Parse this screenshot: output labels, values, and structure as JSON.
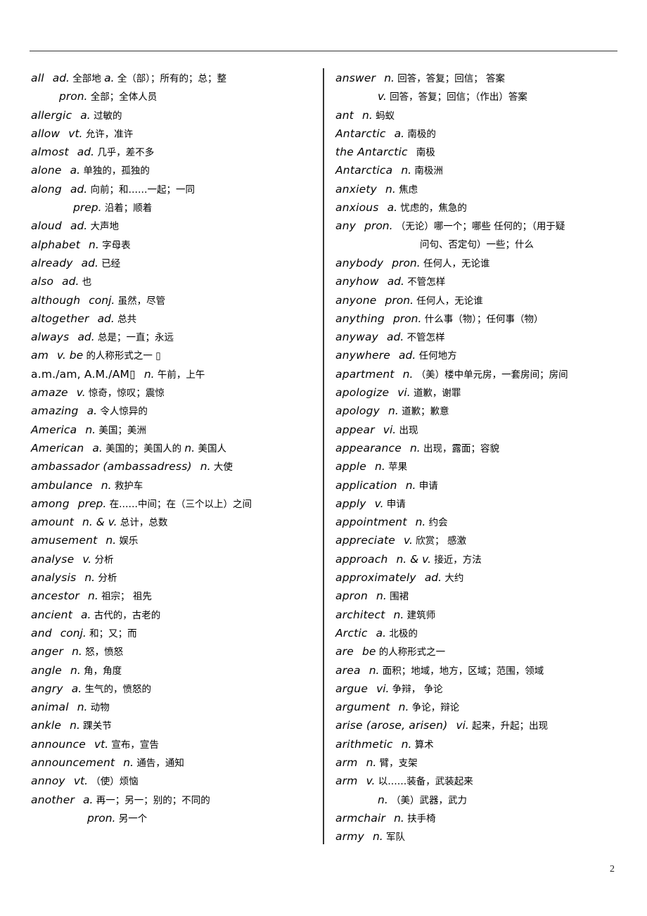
{
  "page_number": "2",
  "left_column": [
    {
      "word": "all",
      "parts": [
        {
          "pos": "ad.",
          "def": "全部地"
        },
        {
          "pos": "a.",
          "def": "全（部）；所有的；总；整"
        }
      ]
    },
    {
      "word": "",
      "indent": 2,
      "parts": [
        {
          "pos": "pron.",
          "def": "全部；全体人员"
        }
      ]
    },
    {
      "word": "allergic",
      "parts": [
        {
          "pos": "a.",
          "def": "过敏的"
        }
      ]
    },
    {
      "word": "allow",
      "parts": [
        {
          "pos": "vt.",
          "def": "允许，准许"
        }
      ]
    },
    {
      "word": "almost",
      "parts": [
        {
          "pos": "ad.",
          "def": "几乎，差不多"
        }
      ]
    },
    {
      "word": "alone",
      "parts": [
        {
          "pos": "a.",
          "def": "单独的，孤独的"
        }
      ]
    },
    {
      "word": "along",
      "parts": [
        {
          "pos": "ad.",
          "def": "向前；和……一起；一同"
        }
      ]
    },
    {
      "word": "",
      "indent": 3,
      "parts": [
        {
          "pos": "prep.",
          "def": "沿着；顺着"
        }
      ]
    },
    {
      "word": "aloud",
      "parts": [
        {
          "pos": "ad.",
          "def": "大声地"
        }
      ]
    },
    {
      "word": "alphabet",
      "parts": [
        {
          "pos": "n.",
          "def": "字母表"
        }
      ]
    },
    {
      "word": "already",
      "parts": [
        {
          "pos": "ad.",
          "def": "已经"
        }
      ]
    },
    {
      "word": "also",
      "parts": [
        {
          "pos": "ad.",
          "def": "也"
        }
      ]
    },
    {
      "word": "although",
      "parts": [
        {
          "pos": "conj.",
          "def": "虽然，尽管"
        }
      ]
    },
    {
      "word": "altogether",
      "parts": [
        {
          "pos": "ad.",
          "def": "总共"
        }
      ]
    },
    {
      "word": "always",
      "parts": [
        {
          "pos": "ad.",
          "def": "总是；一直；永远"
        }
      ]
    },
    {
      "word": "am",
      "parts": [
        {
          "pos": "v. be",
          "def": "的人称形式之一 ▯"
        }
      ]
    },
    {
      "word": "a.m./am, A.M./AM▯",
      "upright": true,
      "parts": [
        {
          "pos": "n.",
          "def": "午前，上午"
        }
      ]
    },
    {
      "word": "amaze",
      "parts": [
        {
          "pos": "v.",
          "def": "惊奇，惊叹；震惊"
        }
      ]
    },
    {
      "word": "amazing",
      "parts": [
        {
          "pos": "a.",
          "def": "令人惊异的"
        }
      ]
    },
    {
      "word": "America",
      "parts": [
        {
          "pos": "n.",
          "def": "美国；美洲"
        }
      ]
    },
    {
      "word": "American",
      "parts": [
        {
          "pos": "a.",
          "def": "美国的；美国人的"
        },
        {
          "pos": "n.",
          "def": "美国人"
        }
      ]
    },
    {
      "word": "ambassador  (ambassadress)",
      "parts": [
        {
          "pos": "n.",
          "def": "大使"
        }
      ]
    },
    {
      "word": "ambulance",
      "parts": [
        {
          "pos": "n.",
          "def": "救护车"
        }
      ]
    },
    {
      "word": "among",
      "parts": [
        {
          "pos": "prep.",
          "def": "在……中间；在（三个以上）之间"
        }
      ]
    },
    {
      "word": "amount",
      "parts": [
        {
          "pos": "n. & v.",
          "def": "总计，总数"
        }
      ]
    },
    {
      "word": "amusement",
      "parts": [
        {
          "pos": "n.",
          "def": "娱乐"
        }
      ]
    },
    {
      "word": "analyse",
      "parts": [
        {
          "pos": "v.",
          "def": "分析"
        }
      ]
    },
    {
      "word": "analysis",
      "parts": [
        {
          "pos": "n.",
          "def": "分析"
        }
      ]
    },
    {
      "word": "ancestor",
      "parts": [
        {
          "pos": "n.",
          "def": "祖宗；  祖先"
        }
      ]
    },
    {
      "word": "ancient",
      "parts": [
        {
          "pos": "a.",
          "def": "古代的，古老的"
        }
      ]
    },
    {
      "word": "and",
      "parts": [
        {
          "pos": "conj.",
          "def": "和；又；而"
        }
      ]
    },
    {
      "word": "anger",
      "parts": [
        {
          "pos": "n.",
          "def": "怒，愤怒"
        }
      ]
    },
    {
      "word": "angle",
      "parts": [
        {
          "pos": "n.",
          "def": "角，角度"
        }
      ]
    },
    {
      "word": "angry",
      "parts": [
        {
          "pos": "a.",
          "def": "生气的，愤怒的"
        }
      ]
    },
    {
      "word": "animal",
      "parts": [
        {
          "pos": "n.",
          "def": "动物"
        }
      ]
    },
    {
      "word": "ankle",
      "parts": [
        {
          "pos": "n.",
          "def": "踝关节"
        }
      ]
    },
    {
      "word": "announce",
      "parts": [
        {
          "pos": "vt.",
          "def": "宣布，宣告"
        }
      ]
    },
    {
      "word": "announcement",
      "parts": [
        {
          "pos": "n.",
          "def": "通告，通知"
        }
      ]
    },
    {
      "word": "annoy",
      "parts": [
        {
          "pos": "vt.",
          "def": "（使）烦恼"
        }
      ]
    },
    {
      "word": "another",
      "parts": [
        {
          "pos": "a.",
          "def": "再一；另一；别的；不同的"
        }
      ]
    },
    {
      "word": "",
      "indent": 4,
      "parts": [
        {
          "pos": "pron.",
          "def": "另一个"
        }
      ]
    }
  ],
  "right_column": [
    {
      "word": "answer",
      "parts": [
        {
          "pos": "n.",
          "def": "回答，答复；回信；  答案"
        }
      ]
    },
    {
      "word": "",
      "indent": 3,
      "parts": [
        {
          "pos": "v.",
          "def": "回答，答复；回信；（作出）答案"
        }
      ]
    },
    {
      "word": "ant",
      "parts": [
        {
          "pos": "n.",
          "def": "蚂蚁"
        }
      ]
    },
    {
      "word": "Antarctic",
      "parts": [
        {
          "pos": "a.",
          "def": "南极的"
        }
      ]
    },
    {
      "word": "the Antarctic",
      "parts": [
        {
          "pos": "",
          "def": "南极"
        }
      ]
    },
    {
      "word": "Antarctica",
      "parts": [
        {
          "pos": "n.",
          "def": "南极洲"
        }
      ]
    },
    {
      "word": "anxiety",
      "parts": [
        {
          "pos": "n.",
          "def": "焦虑"
        }
      ]
    },
    {
      "word": "anxious",
      "parts": [
        {
          "pos": "a.",
          "def": "忧虑的，焦急的"
        }
      ]
    },
    {
      "word": "any",
      "parts": [
        {
          "pos": "pron.",
          "def": "（无论）哪一个；哪些 任何的；（用于疑"
        }
      ]
    },
    {
      "word": "",
      "indent": 6,
      "parts": [
        {
          "pos": "",
          "def": "问句、否定句）一些；什么"
        }
      ]
    },
    {
      "word": "anybody",
      "parts": [
        {
          "pos": "pron.",
          "def": "任何人，无论谁"
        }
      ]
    },
    {
      "word": "anyhow",
      "parts": [
        {
          "pos": "ad.",
          "def": "不管怎样"
        }
      ]
    },
    {
      "word": "anyone",
      "parts": [
        {
          "pos": "pron.",
          "def": "任何人，无论谁"
        }
      ]
    },
    {
      "word": "anything",
      "parts": [
        {
          "pos": "pron.",
          "def": "什么事（物）；任何事（物）"
        }
      ]
    },
    {
      "word": "anyway",
      "parts": [
        {
          "pos": "ad.",
          "def": "不管怎样"
        }
      ]
    },
    {
      "word": "anywhere",
      "parts": [
        {
          "pos": "ad.",
          "def": "任何地方"
        }
      ]
    },
    {
      "word": "apartment",
      "parts": [
        {
          "pos": "n.",
          "def": "（美）楼中单元房，一套房间；房间"
        }
      ]
    },
    {
      "word": "apologize",
      "parts": [
        {
          "pos": "vi.",
          "def": "道歉，谢罪"
        }
      ]
    },
    {
      "word": "apology",
      "parts": [
        {
          "pos": "n.",
          "def": "道歉；歉意"
        }
      ]
    },
    {
      "word": "appear",
      "parts": [
        {
          "pos": "vi.",
          "def": "出现"
        }
      ]
    },
    {
      "word": "appearance",
      "parts": [
        {
          "pos": "n.",
          "def": "出现，露面；容貌"
        }
      ]
    },
    {
      "word": "apple",
      "parts": [
        {
          "pos": "n.",
          "def": "苹果"
        }
      ]
    },
    {
      "word": "application",
      "parts": [
        {
          "pos": "n.",
          "def": "申请"
        }
      ]
    },
    {
      "word": "apply",
      "parts": [
        {
          "pos": "v.",
          "def": "申请"
        }
      ]
    },
    {
      "word": "appointment",
      "parts": [
        {
          "pos": "n.",
          "def": "约会"
        }
      ]
    },
    {
      "word": "appreciate",
      "parts": [
        {
          "pos": "v.",
          "def": "欣赏；  感激"
        }
      ]
    },
    {
      "word": "approach",
      "parts": [
        {
          "pos": "n. & v.",
          "def": "接近，方法"
        }
      ]
    },
    {
      "word": "approximately",
      "parts": [
        {
          "pos": "ad.",
          "def": "大约"
        }
      ]
    },
    {
      "word": "apron",
      "parts": [
        {
          "pos": "n.",
          "def": "围裙"
        }
      ]
    },
    {
      "word": "architect",
      "parts": [
        {
          "pos": "n.",
          "def": "建筑师"
        }
      ]
    },
    {
      "word": "Arctic",
      "parts": [
        {
          "pos": "a.",
          "def": "北极的"
        }
      ]
    },
    {
      "word": "are",
      "parts": [
        {
          "pos": "be",
          "def": "的人称形式之一"
        }
      ]
    },
    {
      "word": "area",
      "parts": [
        {
          "pos": "n.",
          "def": "面积；地域，地方，区域；范围，领域"
        }
      ]
    },
    {
      "word": "argue",
      "parts": [
        {
          "pos": "vi.",
          "def": "争辩，  争论"
        }
      ]
    },
    {
      "word": "argument",
      "parts": [
        {
          "pos": "n.",
          "def": "争论，辩论"
        }
      ]
    },
    {
      "word": "arise (arose, arisen)",
      "parts": [
        {
          "pos": "vi.",
          "def": "起来，升起；出现"
        }
      ]
    },
    {
      "word": "arithmetic",
      "parts": [
        {
          "pos": "n.",
          "def": "算术"
        }
      ]
    },
    {
      "word": "arm",
      "parts": [
        {
          "pos": "n.",
          "def": "臂，支架"
        }
      ]
    },
    {
      "word": "arm",
      "parts": [
        {
          "pos": "v.",
          "def": "以……装备，武装起来"
        }
      ]
    },
    {
      "word": "",
      "indent": 3,
      "parts": [
        {
          "pos": "n.",
          "def": "（美）武器，武力"
        }
      ]
    },
    {
      "word": "armchair",
      "parts": [
        {
          "pos": "n.",
          "def": "扶手椅"
        }
      ]
    },
    {
      "word": "army",
      "parts": [
        {
          "pos": "n.",
          "def": "军队"
        }
      ]
    }
  ]
}
